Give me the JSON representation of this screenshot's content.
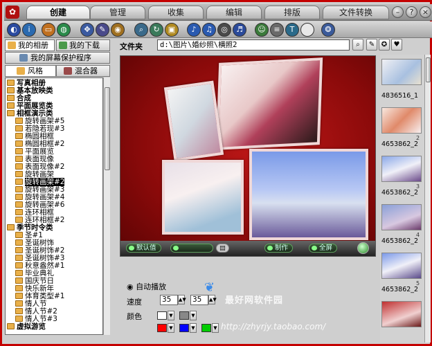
{
  "window": {
    "tabs": [
      "创建",
      "管理",
      "收集",
      "编辑",
      "排版",
      "文件转换"
    ],
    "active_tab": "创建",
    "window_buttons": [
      "minimize",
      "help",
      "close"
    ]
  },
  "toolbar": {
    "icons": [
      "browse-icon",
      "info-icon",
      "folder-icon",
      "globe-icon",
      "move-icon",
      "tools-icon",
      "camera-icon",
      "search-icon",
      "refresh-icon",
      "frame-icon",
      "music-icon",
      "music2-icon",
      "disc-icon",
      "sound-icon",
      "user-icon",
      "config-icon",
      "text-icon",
      "blank-icon",
      "settings-icon"
    ]
  },
  "left_panel": {
    "tab_my_album": "我的相册",
    "tab_my_download": "我的下载",
    "tab_screensaver": "我的屏幕保护程序",
    "tab_style": "风格",
    "tab_mixer": "混合器",
    "tree": [
      {
        "label": "写真相册",
        "type": "cat"
      },
      {
        "label": "基本放映类",
        "type": "cat"
      },
      {
        "label": "合成",
        "type": "cat"
      },
      {
        "label": "平面展览类",
        "type": "cat"
      },
      {
        "label": "相框演示类",
        "type": "cat"
      },
      {
        "label": "旋转画架#5",
        "type": "item"
      },
      {
        "label": "若隐若现#3",
        "type": "item"
      },
      {
        "label": "椭圆相框",
        "type": "item"
      },
      {
        "label": "椭圆相框#2",
        "type": "item"
      },
      {
        "label": "平面展览",
        "type": "item"
      },
      {
        "label": "表面现像",
        "type": "item"
      },
      {
        "label": "表面现像#2",
        "type": "item"
      },
      {
        "label": "旋转画架",
        "type": "item"
      },
      {
        "label": "旋转画架#2",
        "type": "item",
        "selected": true
      },
      {
        "label": "旋转画架#3",
        "type": "item"
      },
      {
        "label": "旋转画架#4",
        "type": "item"
      },
      {
        "label": "旋转画架#6",
        "type": "item"
      },
      {
        "label": "连环相框",
        "type": "item"
      },
      {
        "label": "连环相框#2",
        "type": "item"
      },
      {
        "label": "季节时令类",
        "type": "cat"
      },
      {
        "label": "圣#1",
        "type": "item"
      },
      {
        "label": "圣诞树饰",
        "type": "item"
      },
      {
        "label": "圣诞树饰#2",
        "type": "item"
      },
      {
        "label": "圣诞树饰#3",
        "type": "item"
      },
      {
        "label": "秋意盎然#1",
        "type": "item"
      },
      {
        "label": "毕业典礼",
        "type": "item"
      },
      {
        "label": "国庆节日",
        "type": "item"
      },
      {
        "label": "快乐新年",
        "type": "item"
      },
      {
        "label": "体育类型#1",
        "type": "item"
      },
      {
        "label": "情人节",
        "type": "item"
      },
      {
        "label": "情人节#2",
        "type": "item"
      },
      {
        "label": "情人节#3",
        "type": "item"
      },
      {
        "label": "虚拟游览",
        "type": "cat"
      }
    ]
  },
  "folder": {
    "label": "文件夹",
    "path": "d:\\图片\\婚纱照\\横照2"
  },
  "preview": {
    "btn_default": "默认值",
    "btn_make": "制作",
    "btn_fullscreen": "全屏"
  },
  "controls": {
    "autoplay_label": "自动播放",
    "speed_label": "速度",
    "speed_value_1": "35",
    "speed_value_2": "35",
    "color_label": "颜色",
    "colors": [
      "#ffffff",
      "#888888",
      "#ff0000",
      "#0000ff",
      "#00cc00"
    ]
  },
  "thumbnails": [
    {
      "label": "4836516_1",
      "num": ""
    },
    {
      "label": "4653862_2",
      "num": "2"
    },
    {
      "label": "4653862_2",
      "num": "3"
    },
    {
      "label": "4653862_2",
      "num": "4"
    },
    {
      "label": "4653862_2",
      "num": "5"
    },
    {
      "label": "",
      "num": ""
    }
  ],
  "watermark": {
    "text1": "最好网软件园",
    "text2": "http://zhyrjy.taobao.com/"
  }
}
